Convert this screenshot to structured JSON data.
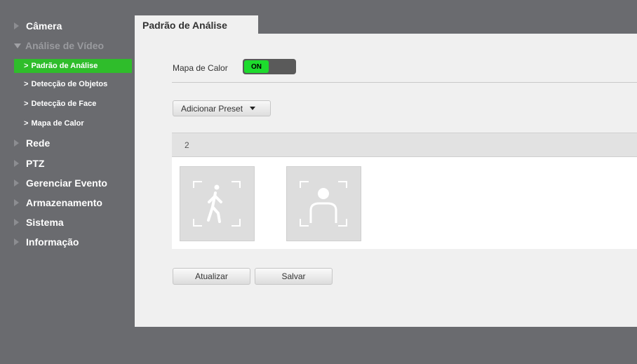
{
  "sidebar": {
    "items": [
      {
        "label": "Câmera"
      },
      {
        "label": "Análise de Vídeo"
      },
      {
        "label": "Rede"
      },
      {
        "label": "PTZ"
      },
      {
        "label": "Gerenciar Evento"
      },
      {
        "label": "Armazenamento"
      },
      {
        "label": "Sistema"
      },
      {
        "label": "Informação"
      }
    ],
    "subitems": [
      {
        "label": "Padrão de Análise"
      },
      {
        "label": "Detecção de Objetos"
      },
      {
        "label": "Detecção de Face"
      },
      {
        "label": "Mapa de Calor"
      }
    ]
  },
  "tab": {
    "label": "Padrão de Análise"
  },
  "heatmap": {
    "label": "Mapa de Calor",
    "toggle_text": "ON",
    "enabled": true
  },
  "preset": {
    "dropdown_label": "Adicionar Preset",
    "number": "2"
  },
  "cards": [
    {
      "icon": "person-walking-icon"
    },
    {
      "icon": "face-detection-icon"
    }
  ],
  "buttons": {
    "refresh": "Atualizar",
    "save": "Salvar"
  },
  "colors": {
    "accent": "#2fbd2b",
    "toggle_on": "#1ddb2d",
    "background": "#6a6b6f"
  }
}
